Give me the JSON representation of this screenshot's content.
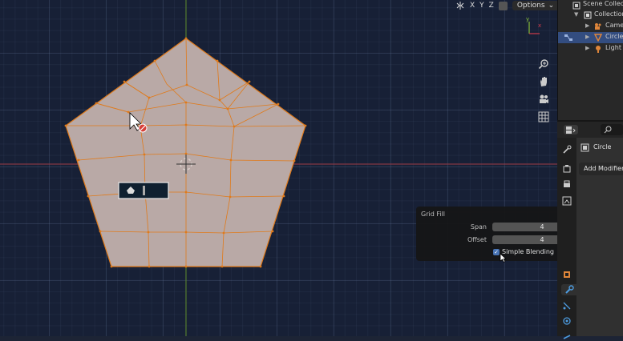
{
  "header": {
    "axes": [
      "X",
      "Y",
      "Z"
    ],
    "options_label": "Options",
    "options_chevron": "⌄"
  },
  "navigation_gizmo": {
    "axis_x": "x",
    "axis_y": "y",
    "axis_z": "z",
    "icons": [
      "zoom-icon",
      "pan-hand-icon",
      "camera-view-icon",
      "grid-ortho-icon"
    ]
  },
  "operator_panel": {
    "title": "Grid Fill",
    "span_label": "Span",
    "span_value": "4",
    "offset_label": "Offset",
    "offset_value": "4",
    "simple_blending_label": "Simple Blending",
    "simple_blending_checked": true
  },
  "outliner": {
    "items": [
      {
        "label": "Scene Collection",
        "icon": "scene-collection-icon",
        "selected": false
      },
      {
        "label": "Collection",
        "icon": "collection-icon",
        "selected": false
      },
      {
        "label": "Camera",
        "icon": "camera-icon",
        "selected": false
      },
      {
        "label": "Circle",
        "icon": "mesh-object-icon",
        "selected": true
      },
      {
        "label": "Light",
        "icon": "light-icon",
        "selected": false
      }
    ]
  },
  "properties": {
    "search_icon": "search-icon",
    "object_name": "Circle",
    "add_modifier_label": "Add Modifier"
  },
  "colors": {
    "mesh_face": "#b9a9a6",
    "mesh_edge": "#e07a1a",
    "axis_x": "#9c3b47",
    "axis_y": "#5c8a28",
    "selection_blue": "#4772b3",
    "viewport_bg": "#172036"
  },
  "texts": {
    "keycast_box": "⬟ ⁞▮"
  }
}
